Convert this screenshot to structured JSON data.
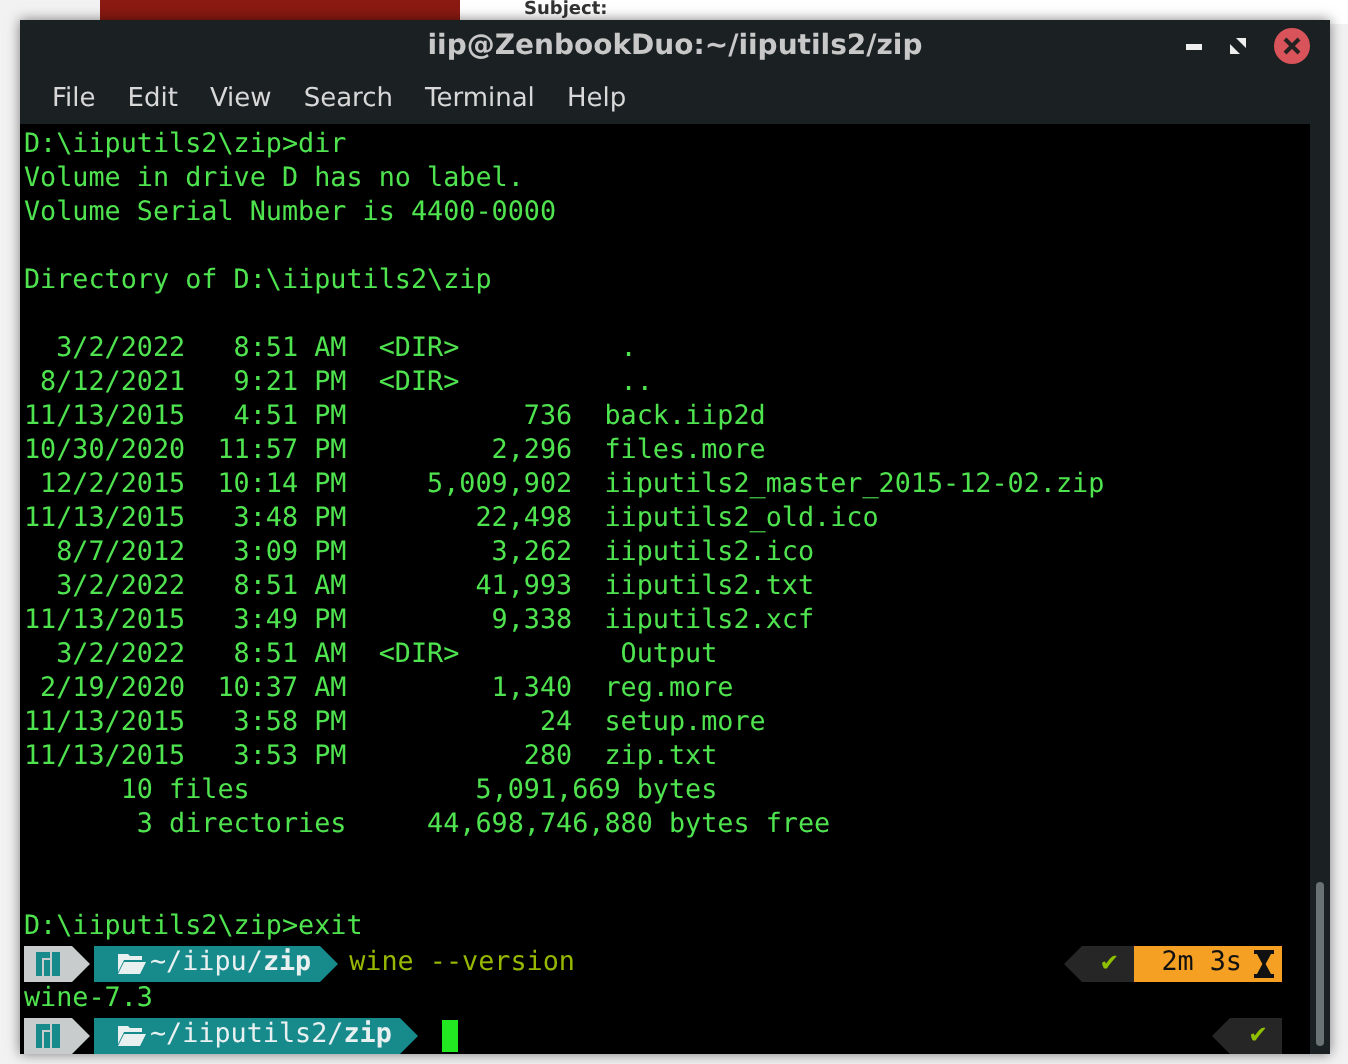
{
  "background": {
    "subject_label": "Subject:"
  },
  "window": {
    "title": "iip@ZenbookDuo:~/iiputils2/zip"
  },
  "menu": [
    "File",
    "Edit",
    "View",
    "Search",
    "Terminal",
    "Help"
  ],
  "terminal": {
    "lines": [
      {
        "kind": "text",
        "text": "D:\\iiputils2\\zip>dir"
      },
      {
        "kind": "text",
        "text": "Volume in drive D has no label."
      },
      {
        "kind": "text",
        "text": "Volume Serial Number is 4400-0000"
      },
      {
        "kind": "blank"
      },
      {
        "kind": "text",
        "text": "Directory of D:\\iiputils2\\zip"
      },
      {
        "kind": "blank"
      },
      {
        "kind": "text",
        "text": "  3/2/2022   8:51 AM  <DIR>          ."
      },
      {
        "kind": "text",
        "text": " 8/12/2021   9:21 PM  <DIR>          .."
      },
      {
        "kind": "text",
        "text": "11/13/2015   4:51 PM           736  back.iip2d"
      },
      {
        "kind": "text",
        "text": "10/30/2020  11:57 PM         2,296  files.more"
      },
      {
        "kind": "text",
        "text": " 12/2/2015  10:14 PM     5,009,902  iiputils2_master_2015-12-02.zip"
      },
      {
        "kind": "text",
        "text": "11/13/2015   3:48 PM        22,498  iiputils2_old.ico"
      },
      {
        "kind": "text",
        "text": "  8/7/2012   3:09 PM         3,262  iiputils2.ico"
      },
      {
        "kind": "text",
        "text": "  3/2/2022   8:51 AM        41,993  iiputils2.txt"
      },
      {
        "kind": "text",
        "text": "11/13/2015   3:49 PM         9,338  iiputils2.xcf"
      },
      {
        "kind": "text",
        "text": "  3/2/2022   8:51 AM  <DIR>          Output"
      },
      {
        "kind": "text",
        "text": " 2/19/2020  10:37 AM         1,340  reg.more"
      },
      {
        "kind": "text",
        "text": "11/13/2015   3:58 PM            24  setup.more"
      },
      {
        "kind": "text",
        "text": "11/13/2015   3:53 PM           280  zip.txt"
      },
      {
        "kind": "text",
        "text": "      10 files              5,091,669 bytes"
      },
      {
        "kind": "text",
        "text": "       3 directories     44,698,746,880 bytes free"
      },
      {
        "kind": "blank"
      },
      {
        "kind": "blank"
      },
      {
        "kind": "text",
        "text": "D:\\iiputils2\\zip>exit"
      },
      {
        "kind": "prompt",
        "path": "~/iipu/",
        "dir": "zip",
        "command": "wine --version",
        "status": "✔",
        "duration": "2m 3s"
      },
      {
        "kind": "text",
        "text": "wine-7.3"
      },
      {
        "kind": "prompt",
        "path": "~/iiputils2/",
        "dir": "zip",
        "status": "✔",
        "cursor": true
      }
    ]
  }
}
